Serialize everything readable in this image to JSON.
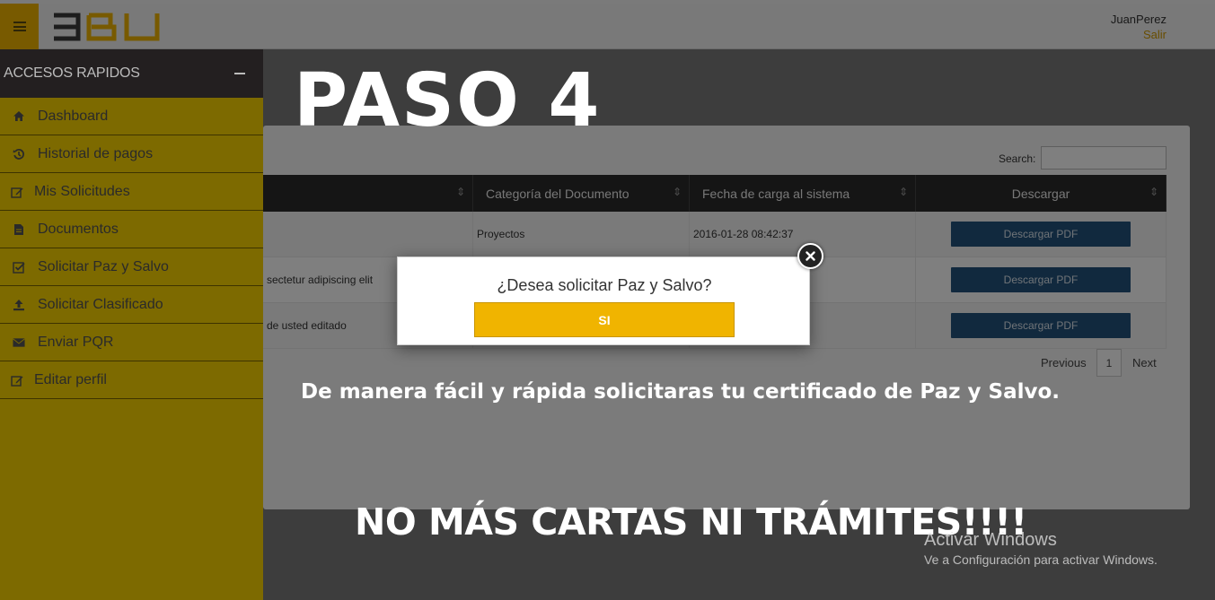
{
  "header": {
    "menu_icon": "hamburger-icon",
    "logo_text": "3BU",
    "user_name": "JuanPerez",
    "logout_label": "Salir"
  },
  "sidebar": {
    "title": "ACCESOS RAPIDOS",
    "items": [
      {
        "label": "Dashboard",
        "icon": "home-icon"
      },
      {
        "label": "Historial de pagos",
        "icon": "history-icon"
      },
      {
        "label": "Mis Solicitudes",
        "icon": "edit-icon"
      },
      {
        "label": "Documentos",
        "icon": "document-icon"
      },
      {
        "label": "Solicitar Paz y Salvo",
        "icon": "check-square-icon"
      },
      {
        "label": "Solicitar Clasificado",
        "icon": "upload-icon"
      },
      {
        "label": "Enviar PQR",
        "icon": "envelope-icon"
      },
      {
        "label": "Editar perfil",
        "icon": "edit-icon"
      }
    ]
  },
  "table": {
    "search_label": "Search:",
    "columns": [
      "",
      "Categoría del Documento",
      "Fecha de carga al sistema",
      "Descargar"
    ],
    "rows": [
      {
        "title": "",
        "category": "Proyectos",
        "date": "2016-01-28 08:42:37",
        "action": "Descargar PDF"
      },
      {
        "title": "sectetur adipiscing elit",
        "category": "",
        "date": "",
        "action": "Descargar PDF"
      },
      {
        "title": "de usted editado",
        "category": "",
        "date": "",
        "action": "Descargar PDF"
      }
    ],
    "pagination": {
      "previous": "Previous",
      "page": "1",
      "next": "Next"
    }
  },
  "modal": {
    "question": "¿Desea solicitar Paz y Salvo?",
    "confirm_label": "SI",
    "close_icon": "close-icon"
  },
  "annotations": {
    "step": "PASO 4",
    "caption": "De manera fácil y rápida solicitaras tu certificado de Paz y Salvo.",
    "slogan": "NO MÁS CARTAS NI TRÁMITES!!!!"
  },
  "watermark": {
    "title": "Activar Windows",
    "subtitle": "Ve a Configuración para activar Windows."
  },
  "colors": {
    "accent": "#f0b400",
    "sidebar_dark": "#231f20",
    "table_header": "#2b2b2b",
    "button_blue": "#23527c"
  }
}
